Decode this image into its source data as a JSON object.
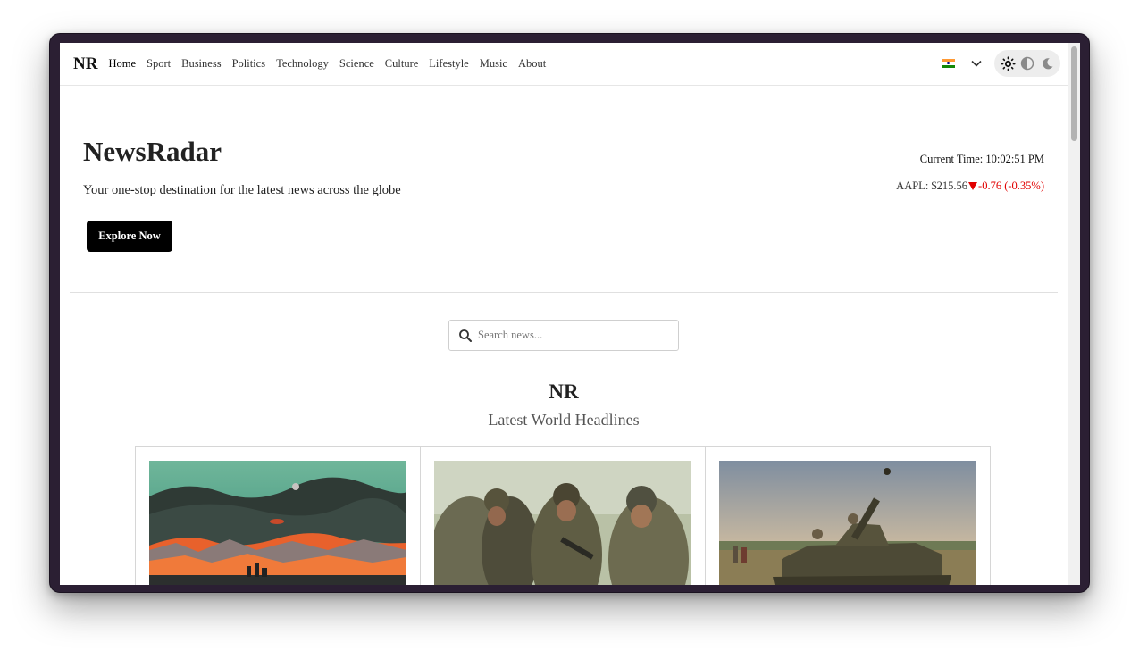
{
  "nav": {
    "logo": "NR",
    "links": [
      "Home",
      "Sport",
      "Business",
      "Politics",
      "Technology",
      "Science",
      "Culture",
      "Lifestyle",
      "Music",
      "About"
    ]
  },
  "hero": {
    "title": "NewsRadar",
    "subtitle": "Your one-stop destination for the latest news across the globe",
    "cta": "Explore Now"
  },
  "widgets": {
    "time_label": "Current Time: 10:02:51 PM",
    "stock_symbol_price": "AAPL: $215.56",
    "stock_change": "-0.76 (-0.35%)",
    "stock_down_color": "#e10000"
  },
  "search": {
    "placeholder": "Search news...",
    "value": ""
  },
  "headlines": {
    "logo": "NR",
    "title": "Latest World Headlines",
    "cards": [
      {
        "image": "sunset-silhouette-illustration"
      },
      {
        "image": "soldiers-photo"
      },
      {
        "image": "tank-field-photo"
      }
    ]
  },
  "icons": {
    "language": "india-flag-icon",
    "chevron": "chevron-down-icon",
    "light_theme": "sun-icon",
    "system_theme": "contrast-icon",
    "dark_theme": "moon-icon",
    "search": "search-icon"
  }
}
